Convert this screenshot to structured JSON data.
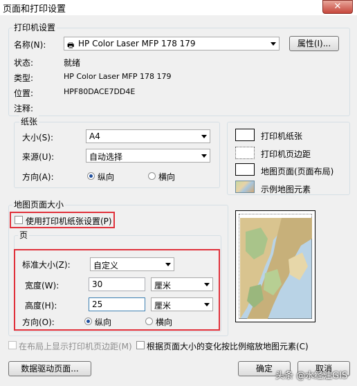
{
  "window": {
    "title": "页面和打印设置",
    "close": "✕"
  },
  "printer": {
    "group": "打印机设置",
    "name_label": "名称(N):",
    "name_value": "HP Color Laser MFP 178 179",
    "properties_btn": "属性(I)...",
    "status_label": "状态:",
    "status_value": "就绪",
    "type_label": "类型:",
    "type_value": "HP Color Laser MFP 178 179",
    "location_label": "位置:",
    "location_value": "HPF80DACE7DD4E",
    "comment_label": "注释:"
  },
  "paper": {
    "group": "纸张",
    "size_label": "大小(S):",
    "size_value": "A4",
    "source_label": "来源(U):",
    "source_value": "自动选择",
    "orientation_label": "方向(A):",
    "portrait": "纵向",
    "landscape": "横向",
    "selected": "portrait"
  },
  "legend": {
    "printer_paper": "打印机纸张",
    "printer_margin": "打印机页边距",
    "map_page": "地图页面(页面布局)",
    "sample": "示例地图元素"
  },
  "map_page_size": {
    "group": "地图页面大小",
    "use_printer_paper": "使用打印机纸张设置(P)",
    "use_printer_checked": false,
    "page_group": "页",
    "std_size_label": "标准大小(Z):",
    "std_size_value": "自定义",
    "width_label": "宽度(W):",
    "width_value": "30",
    "width_unit": "厘米",
    "height_label": "高度(H):",
    "height_value": "25",
    "height_unit": "厘米",
    "orientation_label": "方向(O):",
    "portrait": "纵向",
    "landscape": "横向",
    "selected": "portrait"
  },
  "bottom": {
    "show_margins": "在布局上显示打印机页边距(M)",
    "scale_elements": "根据页面大小的变化按比例缩放地图元素(C)",
    "data_driven_btn": "数据驱动页面...",
    "ok_btn": "确定",
    "cancel_btn": "取消"
  },
  "watermark": "头条 @水经注GIS"
}
